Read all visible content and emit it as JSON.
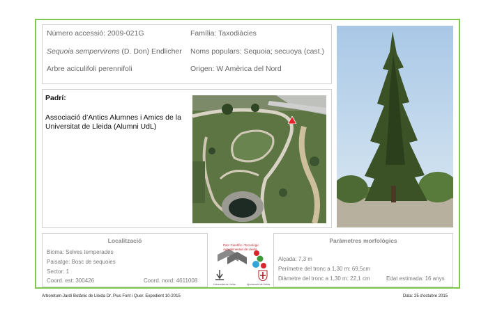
{
  "info": {
    "accession": "Número accessió: 2009-021G",
    "species_italic": "Sequoia sempervirens",
    "species_author": " (D. Don) Endlicher",
    "habit": "Arbre aciculifoli perennifoli",
    "family": "Família:  Taxodiàcies",
    "popular_names": "Noms populars: Sequoia; secuoya (cast.)",
    "origin": "Origen: W Amèrica del Nord"
  },
  "sponsor": {
    "title": "Padrí:",
    "line1": "Associació d’Antics Alumnes i Amics de la",
    "line2": "Universitat de Lleida (Alumni UdL)"
  },
  "location": {
    "title": "Localització",
    "biome": "Bioma: Selves temperades",
    "landscape": "Paisatge: Bosc de sequoies",
    "sector": "Sector: 1",
    "coord_east": "Coord. est: 300426",
    "coord_north": "Coord. nord: 4611008"
  },
  "logos": {
    "park_line1": "Parc Científic i Tecnològic",
    "park_line2": "Agroalimentari de Lleida",
    "udl_caption": "Universitat de Lleida",
    "city_caption": "Ajuntament de Lleida"
  },
  "morphology": {
    "title": "Paràmetres morfològics",
    "height": "Alçada: 7,3 m",
    "perimeter": "Perímetre del tronc a 1,30 m: 69,5cm",
    "diameter": "Diàmetre del tronc a 1,30 m: 22,1 cm",
    "age": "Edat estimada: 16 anys"
  },
  "footer": {
    "left": "Arboretum-Jardí Botànic de Lleida Dr. Pius Font i Quer. Expedient 10-2015",
    "right": "Data: 25 d’octubre 2015"
  },
  "colors": {
    "frame": "#7ec850",
    "marker": "#e8202a"
  }
}
